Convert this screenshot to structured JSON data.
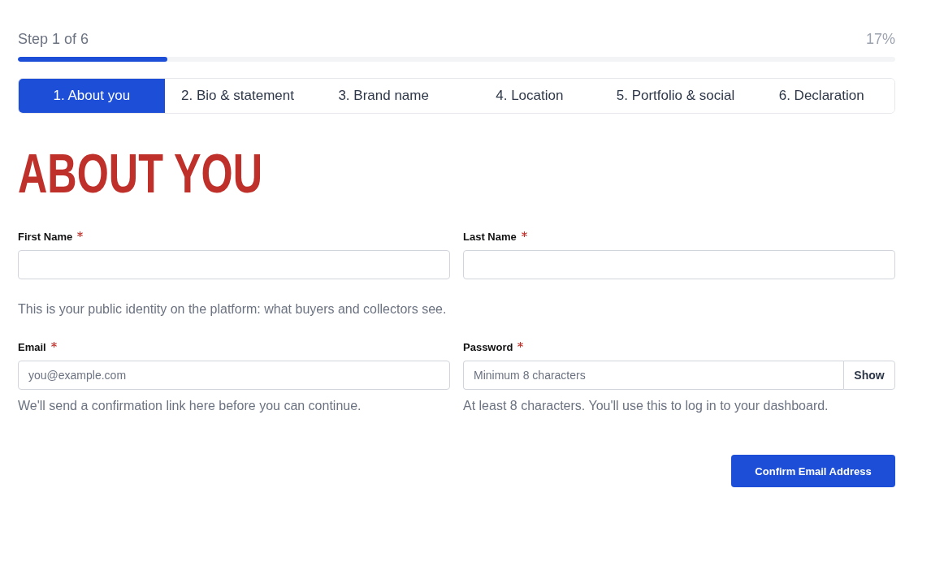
{
  "progress": {
    "step_label": "Step 1 of 6",
    "percent_label": "17%",
    "level": 0.17
  },
  "steps": [
    {
      "label": "1. About you",
      "selected": true
    },
    {
      "label": "2. Bio & statement",
      "selected": false
    },
    {
      "label": "3. Brand name",
      "selected": false
    },
    {
      "label": "4. Location",
      "selected": false
    },
    {
      "label": "5. Portfolio & social",
      "selected": false
    },
    {
      "label": "6. Declaration",
      "selected": false
    }
  ],
  "heading": "ABOUT YOU",
  "name_fields": [
    {
      "label": "First Name",
      "required": true
    },
    {
      "label": "Last Name",
      "required": true
    }
  ],
  "name_note": "This is your public identity on the platform: what buyers and collectors see.",
  "account_fields": [
    {
      "label": "Email",
      "required": true,
      "placeholder": "you@example.com",
      "help": "We'll send a confirmation link here before you can continue."
    },
    {
      "label": "Password",
      "required": true,
      "placeholder": "Minimum 8 characters",
      "toggle_label": "Show",
      "help": "At least 8 characters. You'll use this to log in to your dashboard."
    }
  ],
  "submit_button": "Confirm Email Address"
}
